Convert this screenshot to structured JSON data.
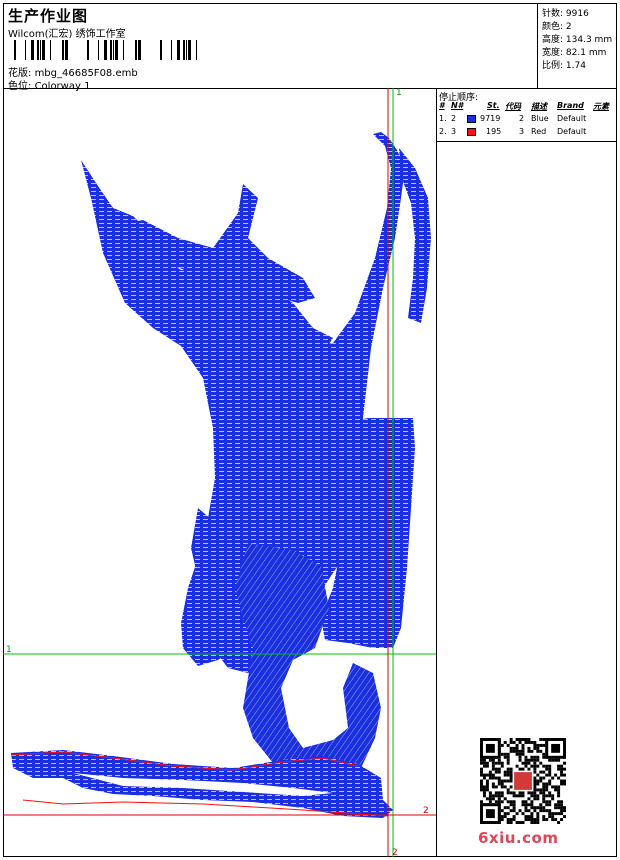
{
  "header": {
    "title": "生产作业图",
    "company": "Wilcom(汇宏) 绣饰工作室",
    "pattern_label": "花版:",
    "pattern_value": "mbg_46685F08.emb",
    "colorway_label": "色位:",
    "colorway_value": "Colorway 1"
  },
  "stats": {
    "stitches_label": "针数:",
    "stitches_value": "9916",
    "colors_label": "颜色:",
    "colors_value": "2",
    "height_label": "高度:",
    "height_value": "134.3 mm",
    "width_label": "宽度:",
    "width_value": "82.1 mm",
    "scale_label": "比例:",
    "scale_value": "1.74"
  },
  "stop_sequence": {
    "title": "停止顺序:",
    "headers": [
      "#",
      "N#",
      "St.",
      "代码",
      "描述",
      "Brand",
      "元素"
    ],
    "rows": [
      {
        "idx": "1.",
        "n": "2",
        "color": "#1a2fe0",
        "st": "9719",
        "code": "2",
        "desc": "Blue",
        "brand": "Default"
      },
      {
        "idx": "2.",
        "n": "3",
        "color": "#ff1010",
        "st": "195",
        "code": "3",
        "desc": "Red",
        "brand": "Default"
      }
    ]
  },
  "guides": {
    "v1": "1",
    "h1": "1",
    "v2": "2",
    "h2": "2"
  },
  "colors": {
    "thread_blue": "#1a2fe0",
    "thread_red": "#ff1010",
    "guide_green": "#00c000",
    "guide_red": "#e00000"
  },
  "watermark": "6xiu.com"
}
